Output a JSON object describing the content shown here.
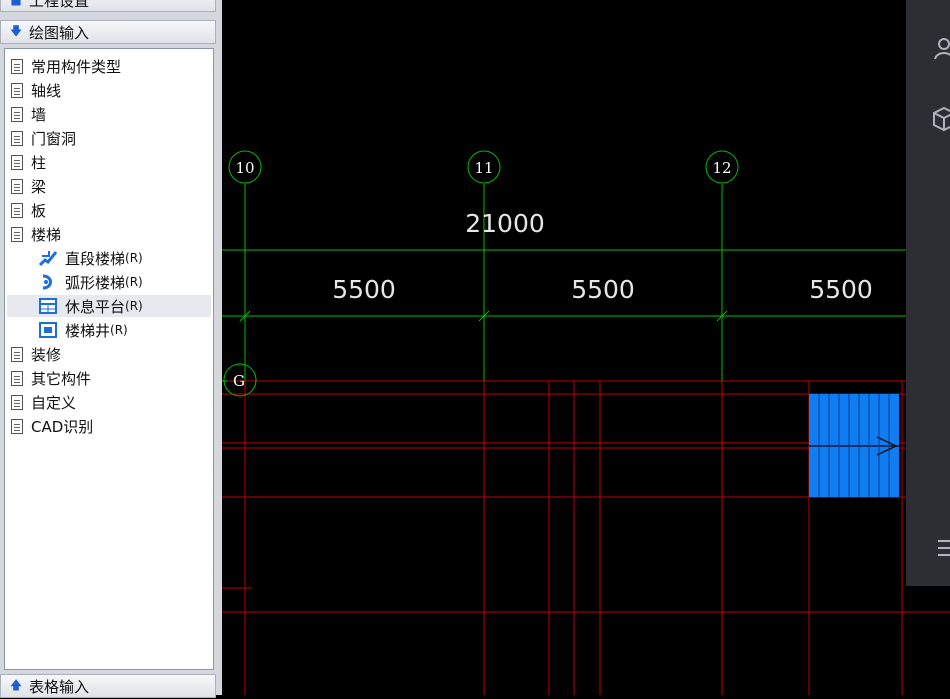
{
  "sidebar": {
    "top_header": "工程设置",
    "draw_header": "绘图输入",
    "bottom_header": "表格输入",
    "items": [
      {
        "label": "常用构件类型"
      },
      {
        "label": "轴线"
      },
      {
        "label": "墙"
      },
      {
        "label": "门窗洞"
      },
      {
        "label": "柱"
      },
      {
        "label": "梁"
      },
      {
        "label": "板"
      },
      {
        "label": "楼梯"
      },
      {
        "label": "直段楼梯",
        "suffix": "(R)"
      },
      {
        "label": "弧形楼梯",
        "suffix": "(R)"
      },
      {
        "label": "休息平台",
        "suffix": "(R)",
        "selected": true
      },
      {
        "label": "楼梯井",
        "suffix": "(R)"
      },
      {
        "label": "装修"
      },
      {
        "label": "其它构件"
      },
      {
        "label": "自定义"
      },
      {
        "label": "CAD识别"
      }
    ]
  },
  "drawing": {
    "axes": [
      {
        "label": "10"
      },
      {
        "label": "11"
      },
      {
        "label": "12"
      },
      {
        "label": "G"
      }
    ],
    "total_dimension": "21000",
    "span_dimensions": [
      "5500",
      "5500",
      "5500"
    ]
  },
  "colors": {
    "canvas_bg": "#000000",
    "axis_green": "#00c000",
    "grid_red": "#c00000",
    "stair_blue": "#0f7df2",
    "dim_text": "#e6e6e6"
  },
  "icons": {
    "header_collapse": "arrow-down-icon",
    "header_expand": "arrow-up-icon",
    "folder": "document-icon",
    "dock_user": "user-icon",
    "dock_cube": "cube-icon",
    "dock_menu": "menu-icon"
  }
}
